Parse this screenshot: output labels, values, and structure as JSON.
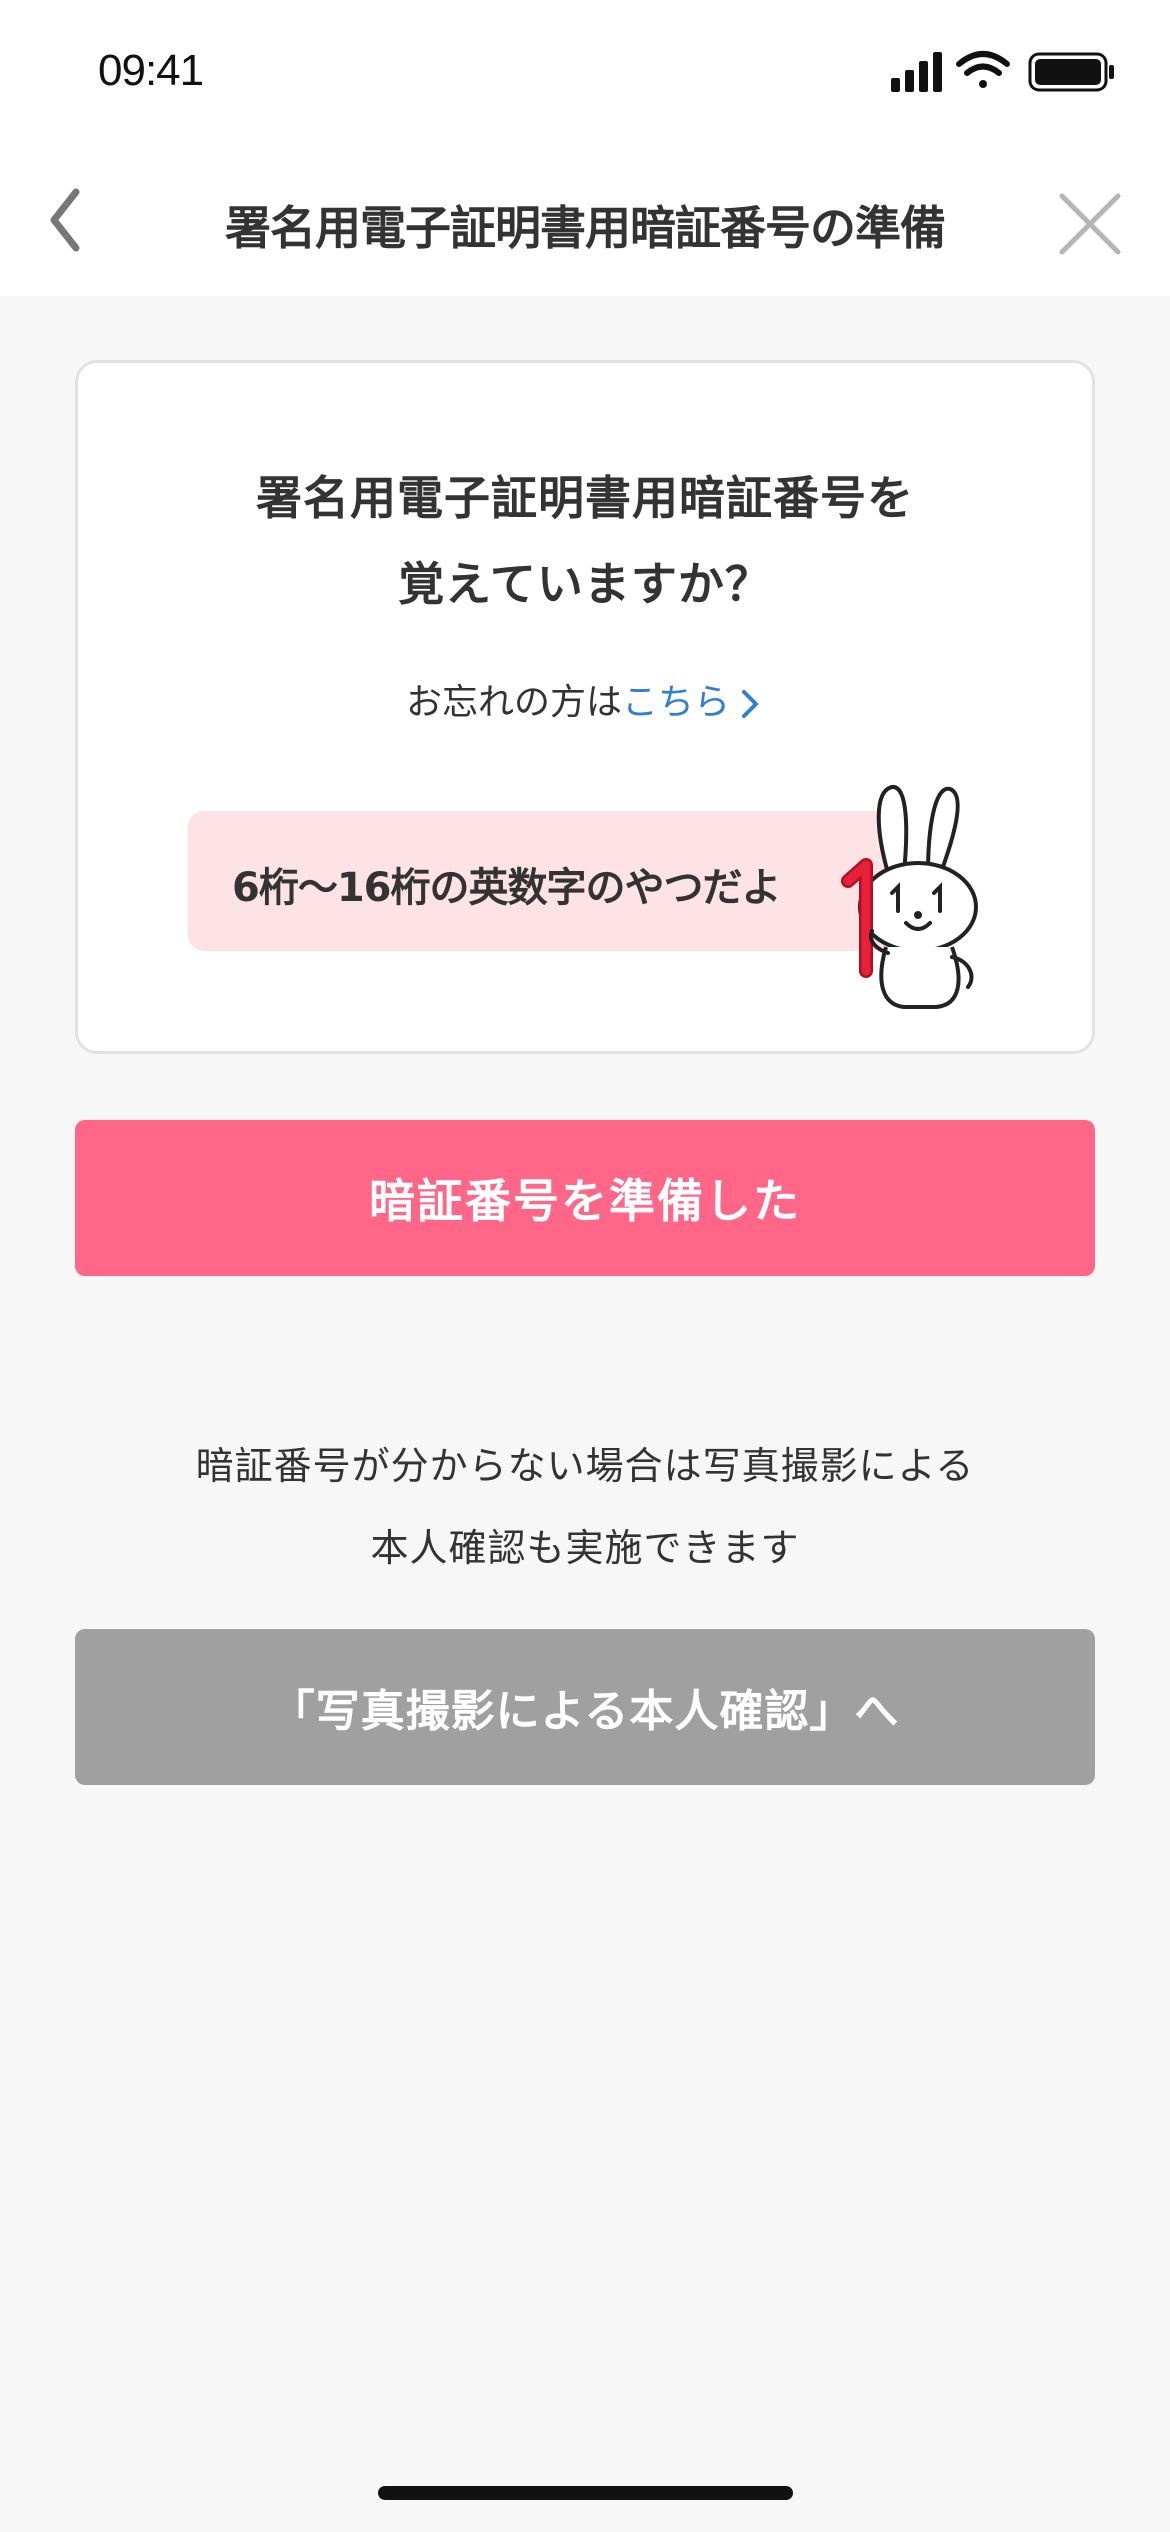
{
  "status_bar": {
    "time": "09:41",
    "icons": [
      "cellular-signal-icon",
      "wifi-icon",
      "battery-icon"
    ]
  },
  "nav": {
    "title": "署名用電子証明書用暗証番号の準備",
    "back_icon": "chevron-left-icon",
    "close_icon": "close-icon"
  },
  "card": {
    "question_line1": "署名用電子証明書用暗証番号を",
    "question_line2": "覚えていますか？",
    "forgot_prefix": "お忘れの方は",
    "forgot_link": "こちら",
    "hint": "6桁〜16桁の英数字のやつだよ",
    "mascot_icon": "rabbit-mascot-icon"
  },
  "primary_button": {
    "label": "暗証番号を準備した"
  },
  "info": {
    "line1": "暗証番号が分からない場合は写真撮影による",
    "line2": "本人確認も実施できます"
  },
  "secondary_button": {
    "label": "「写真撮影による本人確認」へ"
  },
  "colors": {
    "primary": "#ff6688",
    "secondary": "#a0a0a0",
    "link": "#2f7fd3",
    "hint_background": "#fde3e6",
    "background": "#f7f7f7"
  }
}
